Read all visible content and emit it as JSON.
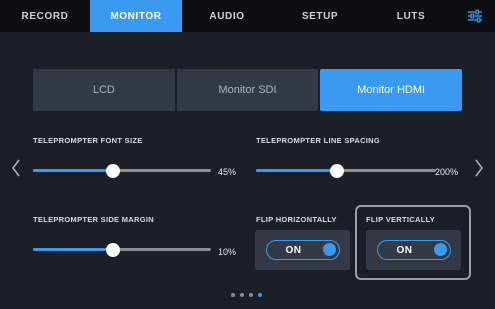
{
  "tabs": [
    {
      "label": "RECORD",
      "active": false
    },
    {
      "label": "MONITOR",
      "active": true
    },
    {
      "label": "AUDIO",
      "active": false
    },
    {
      "label": "SETUP",
      "active": false
    },
    {
      "label": "LUTS",
      "active": false
    }
  ],
  "settings_icon": "sliders-icon",
  "monitor_select": {
    "options": [
      "LCD",
      "Monitor SDI",
      "Monitor HDMI"
    ],
    "selected": "Monitor HDMI"
  },
  "nav": {
    "prev_icon": "chevron-left-icon",
    "next_icon": "chevron-right-icon"
  },
  "teleprompter_font_size": {
    "label": "TELEPROMPTER FONT SIZE",
    "value_text": "45%",
    "level": 0.45
  },
  "teleprompter_line_spacing": {
    "label": "TELEPROMPTER LINE SPACING",
    "value_text": "200%",
    "level": 0.45
  },
  "teleprompter_side_margin": {
    "label": "TELEPROMPTER SIDE MARGIN",
    "value_text": "10%",
    "level": 0.45
  },
  "flip_horizontally": {
    "label": "FLIP HORIZONTALLY",
    "state": "ON"
  },
  "flip_vertically": {
    "label": "FLIP VERTICALLY",
    "state": "ON"
  },
  "pagination": {
    "pages": 4,
    "current": 4
  },
  "colors": {
    "accent": "#3a99f0",
    "background": "#1a1f28",
    "tabbar": "#0c0e12",
    "panel": "#343a45"
  }
}
